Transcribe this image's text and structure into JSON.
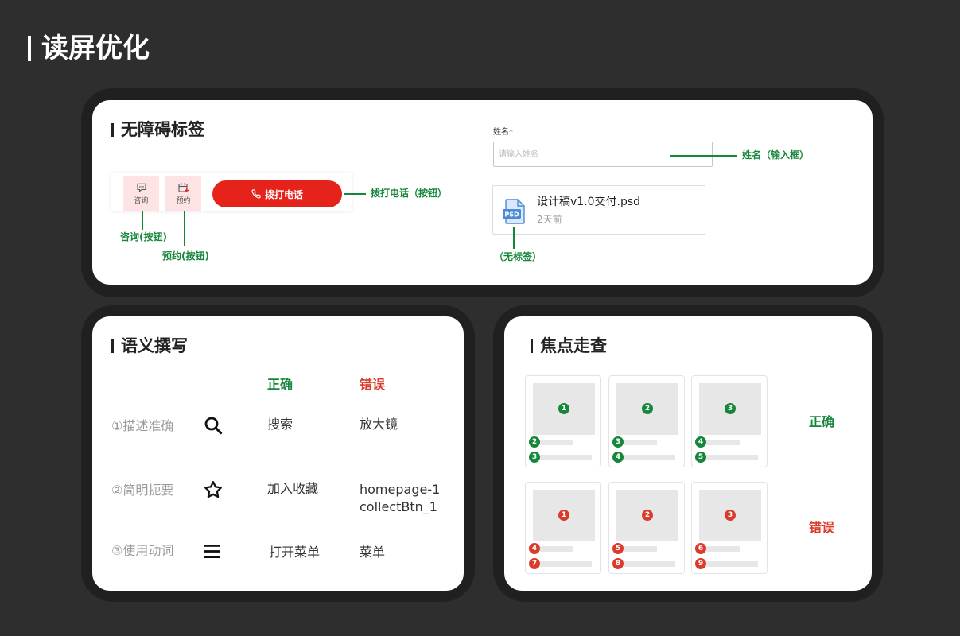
{
  "page": {
    "title": "读屏优化"
  },
  "a11y_labels": {
    "title": "无障碍标签",
    "toolbar": {
      "consult": {
        "label": "咨询",
        "icon": "chat-icon"
      },
      "reserve": {
        "label": "预约",
        "icon": "calendar-add-icon"
      },
      "call": {
        "label": "拨打电话",
        "icon": "phone-icon"
      }
    },
    "form": {
      "name_label": "姓名",
      "required_mark": "*",
      "name_placeholder": "请输入姓名"
    },
    "file": {
      "name": "设计稿v1.0交付.psd",
      "time": "2天前",
      "icon": "psd-file-icon",
      "icon_text": "PSD"
    },
    "annotations": {
      "consult": "咨询(按钮)",
      "reserve": "预约(按钮)",
      "call": "拨打电话（按钮）",
      "name_input": "姓名（输入框）",
      "file": "（无标签）"
    }
  },
  "semantic_writing": {
    "title": "语义撰写",
    "headers": {
      "correct": "正确",
      "wrong": "错误"
    },
    "rows": [
      {
        "rule": "①描述准确",
        "icon": "search-icon",
        "correct": "搜索",
        "wrong_lines": [
          "放大镜"
        ]
      },
      {
        "rule": "②简明扼要",
        "icon": "star-icon",
        "correct": "加入收藏",
        "wrong_lines": [
          "homepage-1",
          "collectBtn_1"
        ]
      },
      {
        "rule": "③使用动词",
        "icon": "menu-icon",
        "correct": "打开菜单",
        "wrong_lines": [
          "菜单"
        ]
      }
    ]
  },
  "focus_walkthrough": {
    "title": "焦点走查",
    "rows": [
      {
        "label": "正确",
        "cards": [
          {
            "main": "1",
            "items": [
              "2",
              "3"
            ]
          },
          {
            "main": "2",
            "items": [
              "3",
              "4"
            ]
          },
          {
            "main": "3",
            "items": [
              "4",
              "5"
            ]
          }
        ]
      },
      {
        "label": "错误",
        "cards": [
          {
            "main": "1",
            "items": [
              "4",
              "7"
            ]
          },
          {
            "main": "2",
            "items": [
              "5",
              "8"
            ]
          },
          {
            "main": "3",
            "items": [
              "6",
              "9"
            ]
          }
        ]
      }
    ]
  },
  "colors": {
    "accent_green": "#16873a",
    "accent_red": "#dc3b2c",
    "call_button": "#e6231b",
    "button_tint": "#fde3e3",
    "frame": "#202020",
    "background": "#2e2e2e"
  }
}
